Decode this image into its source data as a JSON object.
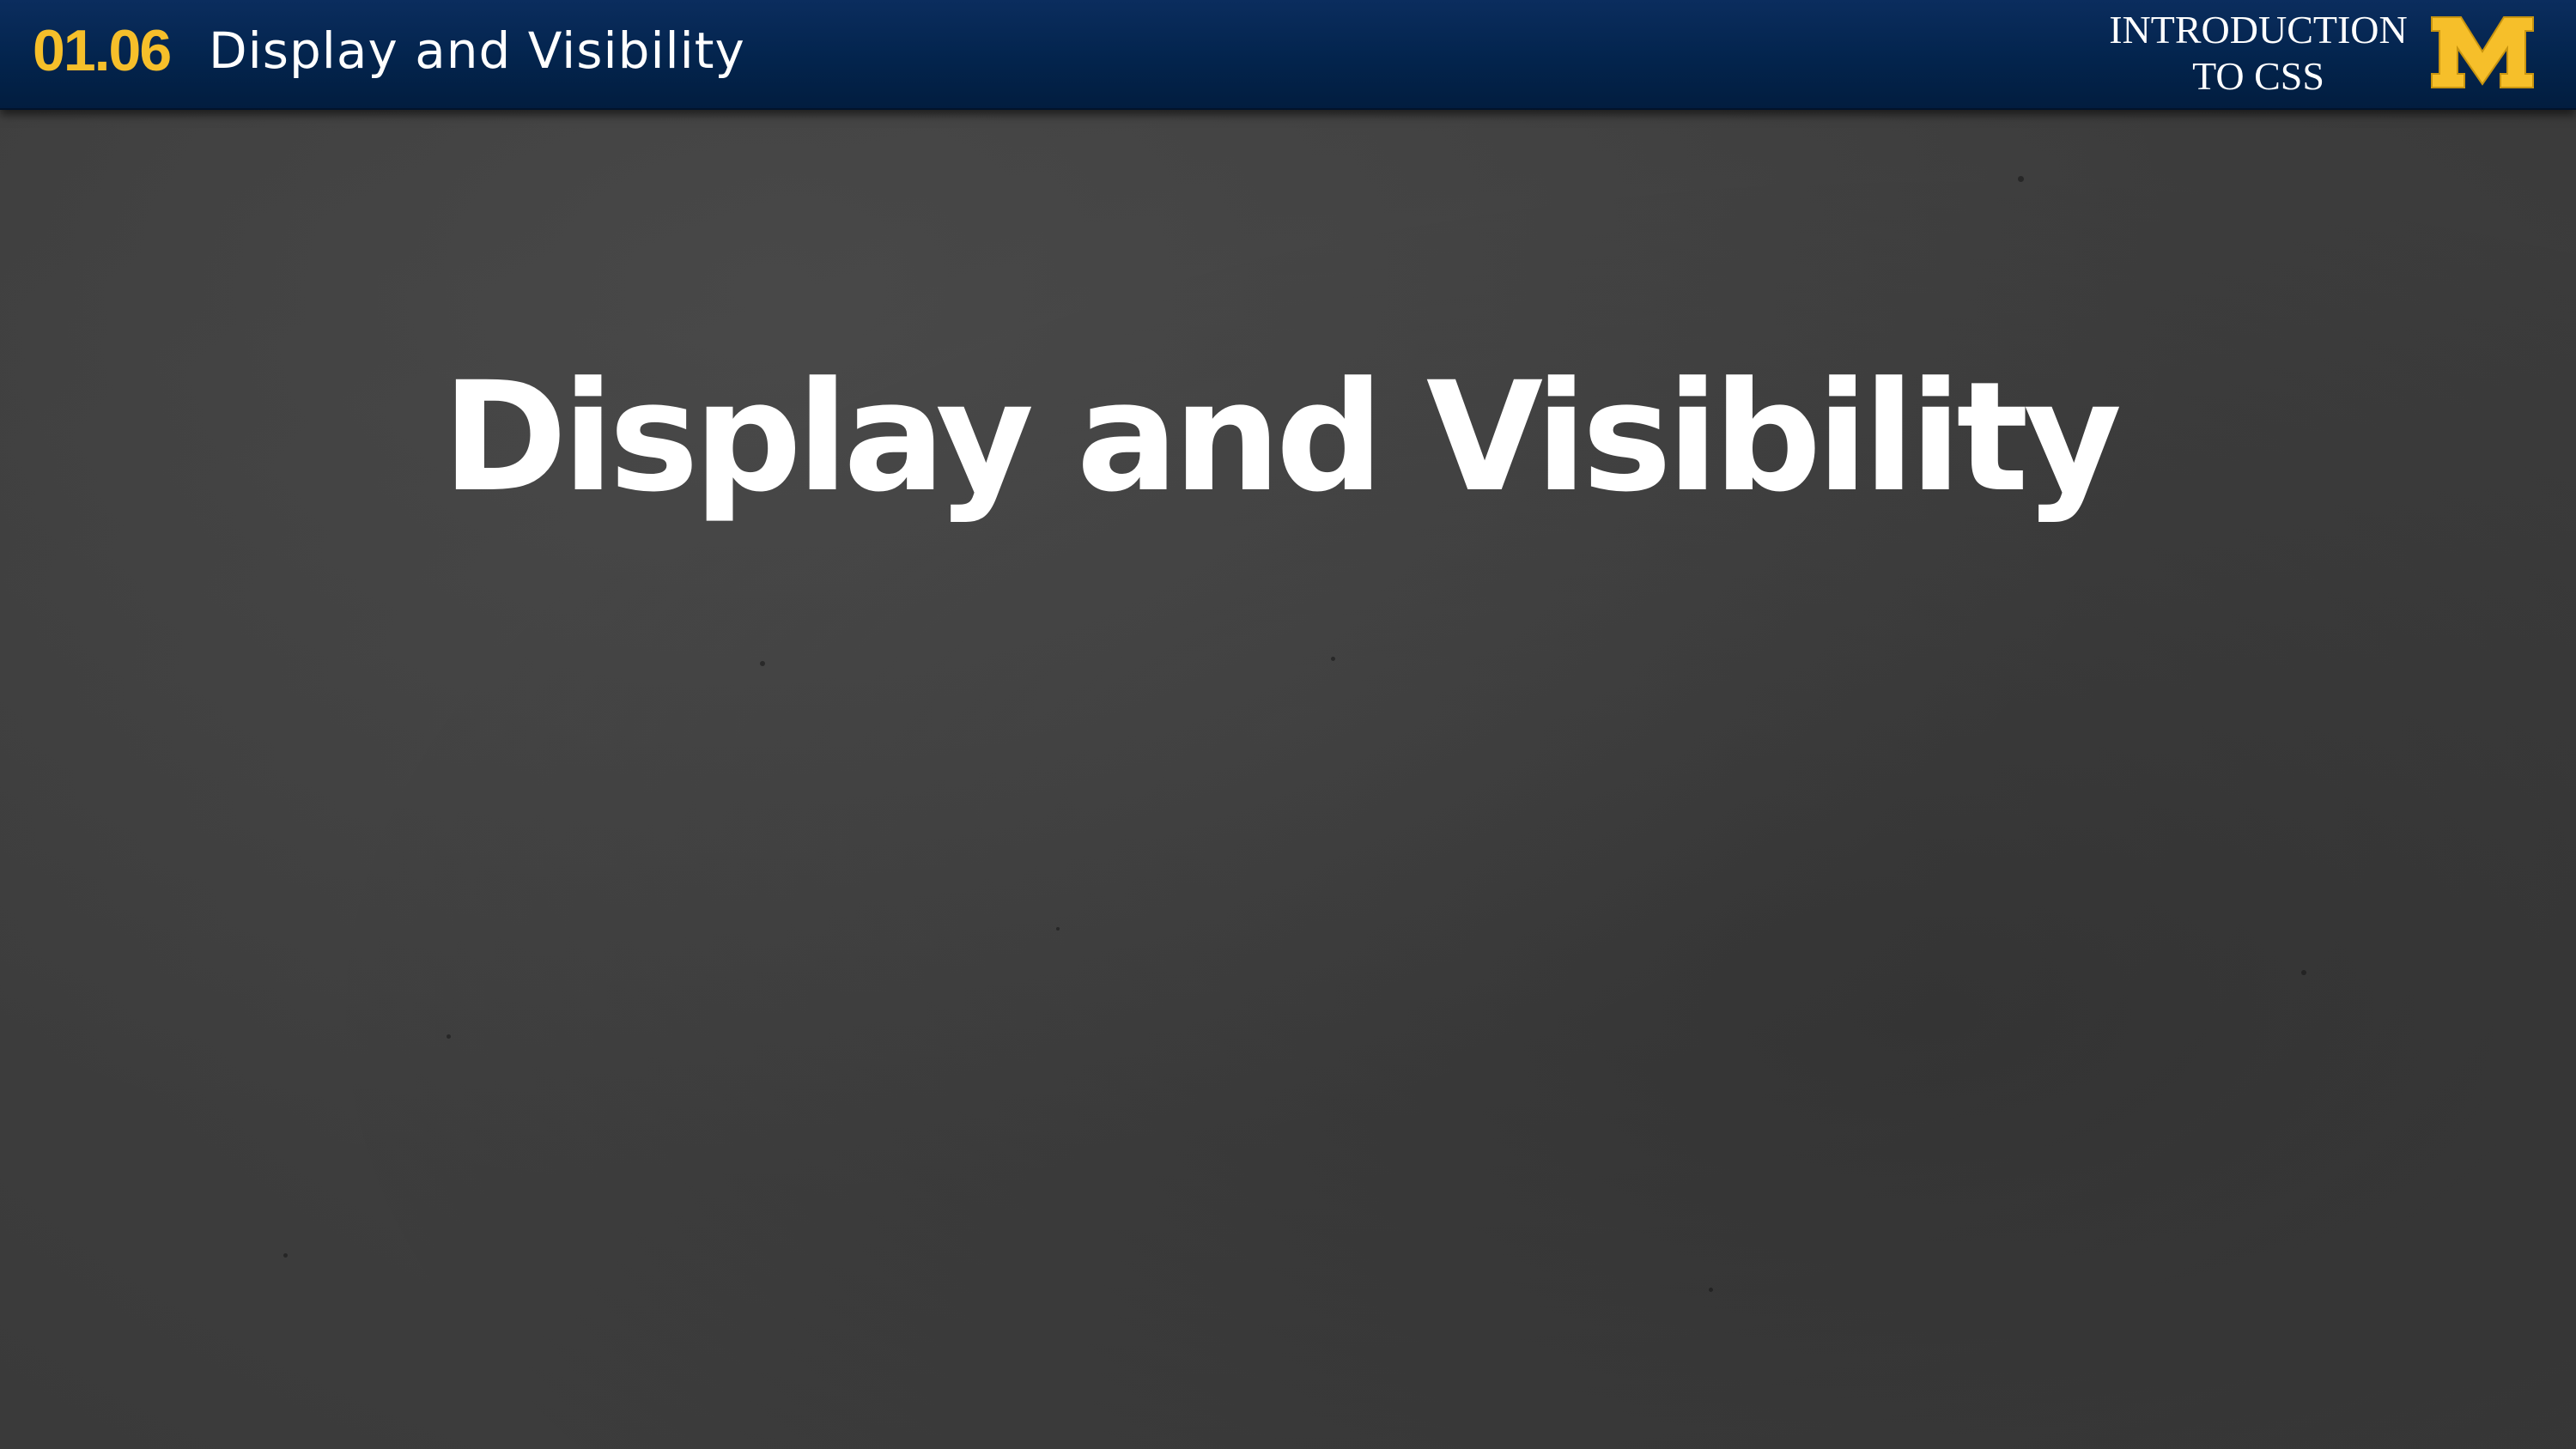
{
  "header": {
    "lesson_number": "01.06",
    "title": "Display and Visibility",
    "course_line1": "INTRODUCTION",
    "course_line2": "TO CSS",
    "logo_icon": "block-m-logo-icon",
    "logo_letter": "M"
  },
  "slide": {
    "title": "Display and Visibility"
  },
  "colors": {
    "header_navy": "#03244d",
    "maize": "#f6bf2a",
    "slide_background": "#3f3f3f",
    "title_text": "#ffffff"
  }
}
